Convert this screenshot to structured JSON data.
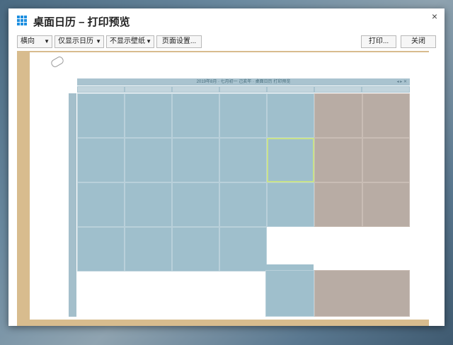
{
  "window": {
    "title": "桌面日历 – 打印预览",
    "close_glyph": "×"
  },
  "toolbar": {
    "orientation": "横向",
    "range": "仅显示日历",
    "wallpaper": "不显示壁纸",
    "page_setup": "页面设置...",
    "print": "打印...",
    "close": "关闭",
    "dropdown_glyph": "▼"
  },
  "preview": {
    "calendar_title": "2019年8月 · 七月初一 己亥年 · 桌面日历 打印预览",
    "title_icons": "◂ ▸ ✕"
  },
  "colors": {
    "weekday": "#9fbfcc",
    "weekend": "#b8aca4",
    "paper_bg": "#d8bc8e",
    "today_border": "#c8e28a"
  },
  "icons": [
    "calendar-grid-icon",
    "close-icon",
    "chevron-down-icon",
    "paperclip-icon"
  ]
}
